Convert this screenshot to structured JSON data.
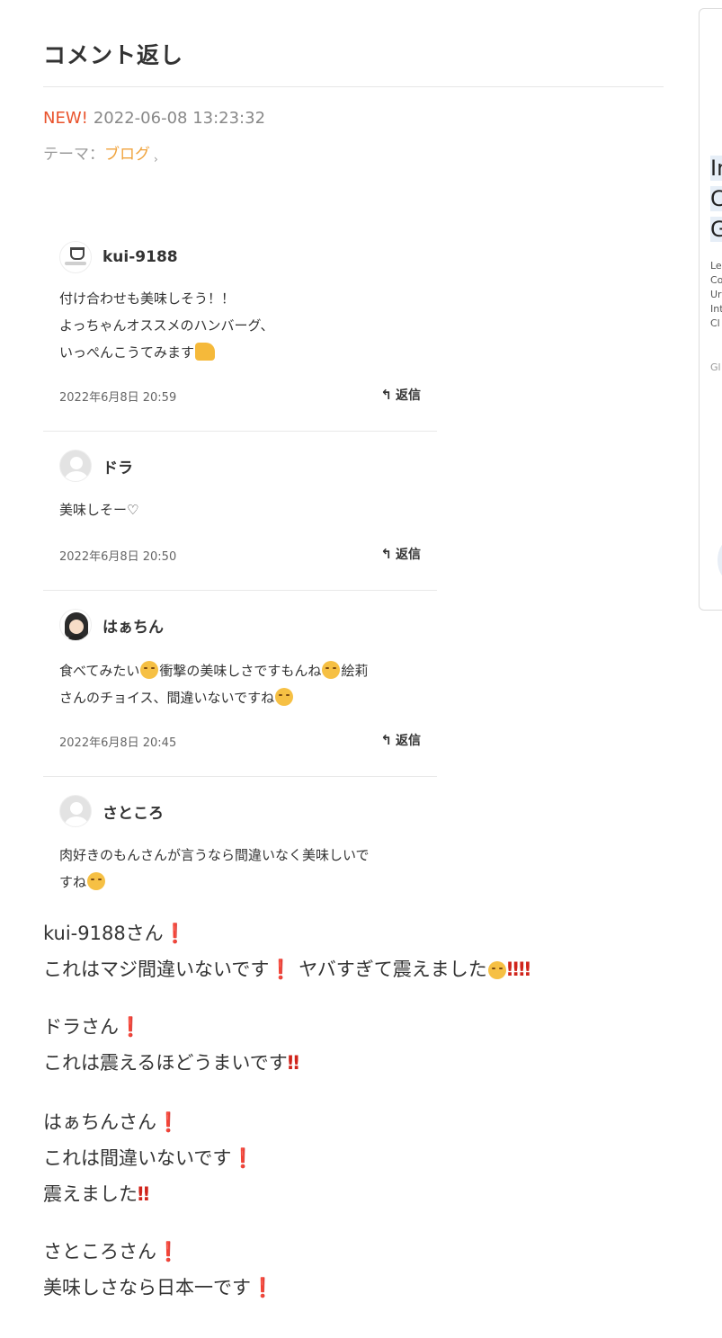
{
  "header": {
    "title": "コメント返し",
    "new_badge": "NEW!",
    "datetime": "2022-06-08 13:23:32",
    "theme_label": "テーマ：",
    "theme_value": "ブログ",
    "theme_chevron": "›"
  },
  "comments": [
    {
      "user": "kui-9188",
      "avatar": "trophy-logo",
      "lines": [
        "付け合わせも美味しそう！！",
        "よっちゃんオススメのハンバーグ、",
        "いっぺんこうてみます"
      ],
      "date": "2022年6月8日 20:59",
      "reply_label": "返信"
    },
    {
      "user": "ドラ",
      "avatar": "default",
      "lines": [
        "美味しそー♡"
      ],
      "date": "2022年6月8日 20:50",
      "reply_label": "返信"
    },
    {
      "user": "はぁちん",
      "avatar": "girl",
      "line1_a": "食べてみたい",
      "line1_b": "衝撃の美味しさですもんね",
      "line1_c": "絵莉",
      "line2": "さんのチョイス、間違いないですね",
      "date": "2022年6月8日 20:45",
      "reply_label": "返信"
    },
    {
      "user": "さところ",
      "avatar": "default",
      "lines": [
        "肉好きのもんさんが言うなら間違いなく美味しいで",
        "すね"
      ]
    }
  ],
  "post": {
    "p1_l1": "kui-9188さん",
    "p1_l2_a": "これはマジ間違いないです",
    "p1_l2_b": " ヤバすぎて震えました",
    "p2_l1": "ドラさん",
    "p2_l2": "これは震えるほどうまいです",
    "p3_l1": "はぁちんさん",
    "p3_l2": "これは間違いないです",
    "p3_l3": "震えました",
    "p4_l1": "さところさん",
    "p4_l2": "美味しさなら日本一です",
    "exclaim": "❗",
    "double_exclaim": "‼"
  },
  "sidebar_ad": {
    "big_lines": [
      "In",
      "C",
      "G"
    ],
    "small_lines": [
      "Le",
      "Co",
      "Ur",
      "Int",
      "Cl"
    ],
    "footer": "Gl"
  }
}
